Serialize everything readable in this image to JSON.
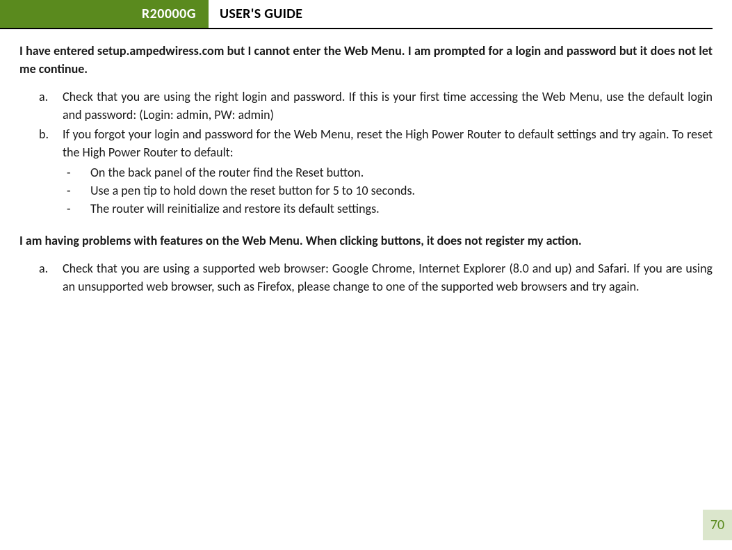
{
  "header": {
    "model": "R20000G",
    "title": "USER'S GUIDE"
  },
  "sections": [
    {
      "question": "I have entered setup.ampedwiress.com but I cannot enter the Web Menu.  I am prompted for a login and password but it does not let me continue.",
      "items": [
        {
          "marker": "a.",
          "text": "Check that you are using the right login and password.  If this is your first time accessing the Web Menu, use the default login and password: (Login: admin, PW: admin)"
        },
        {
          "marker": "b.",
          "text": "If you forgot your login and password for the Web Menu, reset the High Power Router to default settings and try again.  To reset the High Power Router to default:",
          "subitems": [
            {
              "marker": "-",
              "text": "On the back panel of the router find the Reset button."
            },
            {
              "marker": "-",
              "text": "Use a pen tip to hold down the reset button for 5 to 10 seconds."
            },
            {
              "marker": "-",
              "text": "The router will reinitialize and restore its default settings."
            }
          ]
        }
      ]
    },
    {
      "question": "I am having problems with features on the Web Menu.  When clicking buttons, it does not register my action.",
      "items": [
        {
          "marker": "a.",
          "text": "Check that you are using a supported web browser: Google Chrome, Internet Explorer (8.0 and up) and Safari.  If you are using an unsupported web browser, such as Firefox, please change to one of the supported web browsers and try again."
        }
      ]
    }
  ],
  "page_number": "70"
}
